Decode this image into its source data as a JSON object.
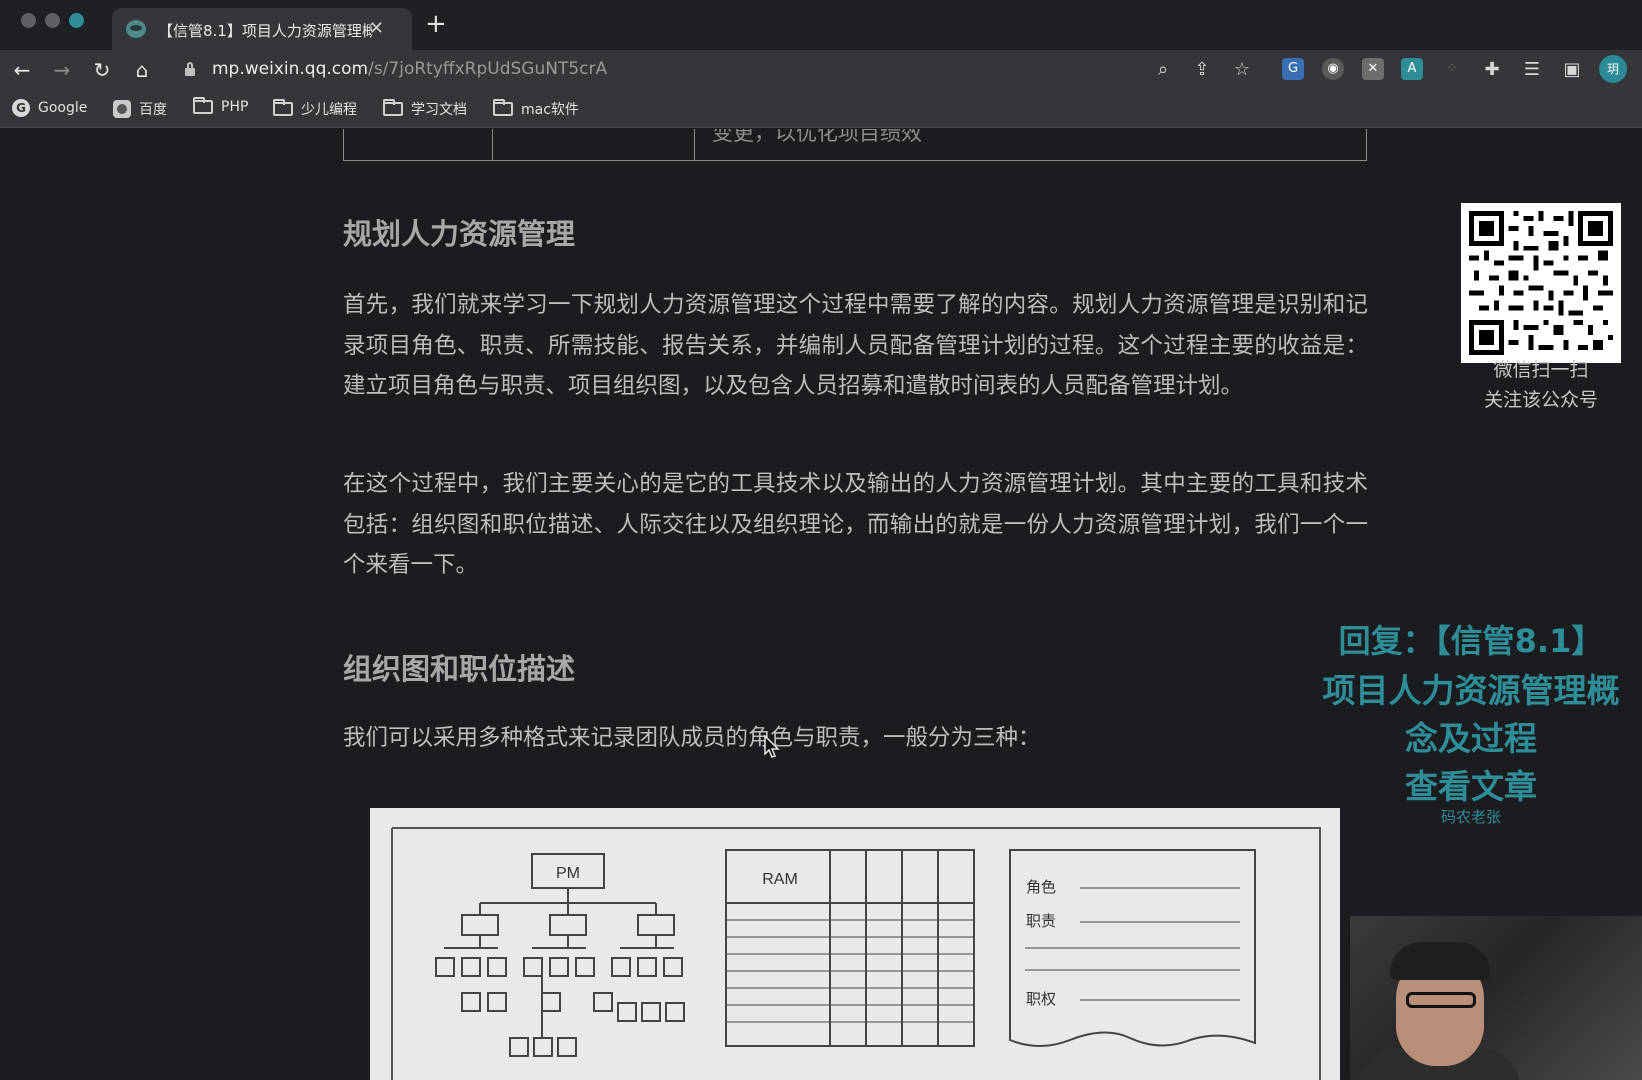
{
  "browser": {
    "tab_title": "【信管8.1】项目人力资源管理概",
    "url_host": "mp.weixin.qq.com",
    "url_path": "/s/7joRtyffxRpUdSGuNT5crA",
    "profile_initial": "玥",
    "bookmarks": [
      {
        "label": "Google",
        "icon": "google-icon"
      },
      {
        "label": "百度",
        "icon": "baidu-icon"
      },
      {
        "label": "PHP",
        "icon": "folder-icon"
      },
      {
        "label": "少儿编程",
        "icon": "folder-icon"
      },
      {
        "label": "学习文档",
        "icon": "folder-icon"
      },
      {
        "label": "mac软件",
        "icon": "folder-icon"
      }
    ]
  },
  "article": {
    "table_fragment": "变更，以优化项目绩效",
    "section1_title": "规划人力资源管理",
    "section1_para1": "首先，我们就来学习一下规划人力资源管理这个过程中需要了解的内容。规划人力资源管理是识别和记录项目角色、职责、所需技能、报告关系，并编制人员配备管理计划的过程。这个过程主要的收益是：建立项目角色与职责、项目组织图，以及包含人员招募和遣散时间表的人员配备管理计划。",
    "section1_para2": "在这个过程中，我们主要关心的是它的工具技术以及输出的人力资源管理计划。其中主要的工具和技术包括：组织图和职位描述、人际交往以及组织理论，而输出的就是一份人力资源管理计划，我们一个一个来看一下。",
    "section2_title": "组织图和职位描述",
    "section2_para1": "我们可以采用多种格式来记录团队成员的角色与职责，一般分为三种：",
    "figure": {
      "org_root": "PM",
      "matrix_label": "RAM",
      "form_fields": [
        "角色",
        "职责",
        "职权"
      ]
    }
  },
  "sidebar": {
    "qr_caption_line1": "微信扫一扫",
    "qr_caption_line2": "关注该公众号"
  },
  "promo": {
    "line1": "回复：【信管8.1】",
    "line2": "项目人力资源管理概",
    "line3": "念及过程",
    "line4": "查看文章",
    "author": "码农老张",
    "color": "#2e8d97"
  }
}
